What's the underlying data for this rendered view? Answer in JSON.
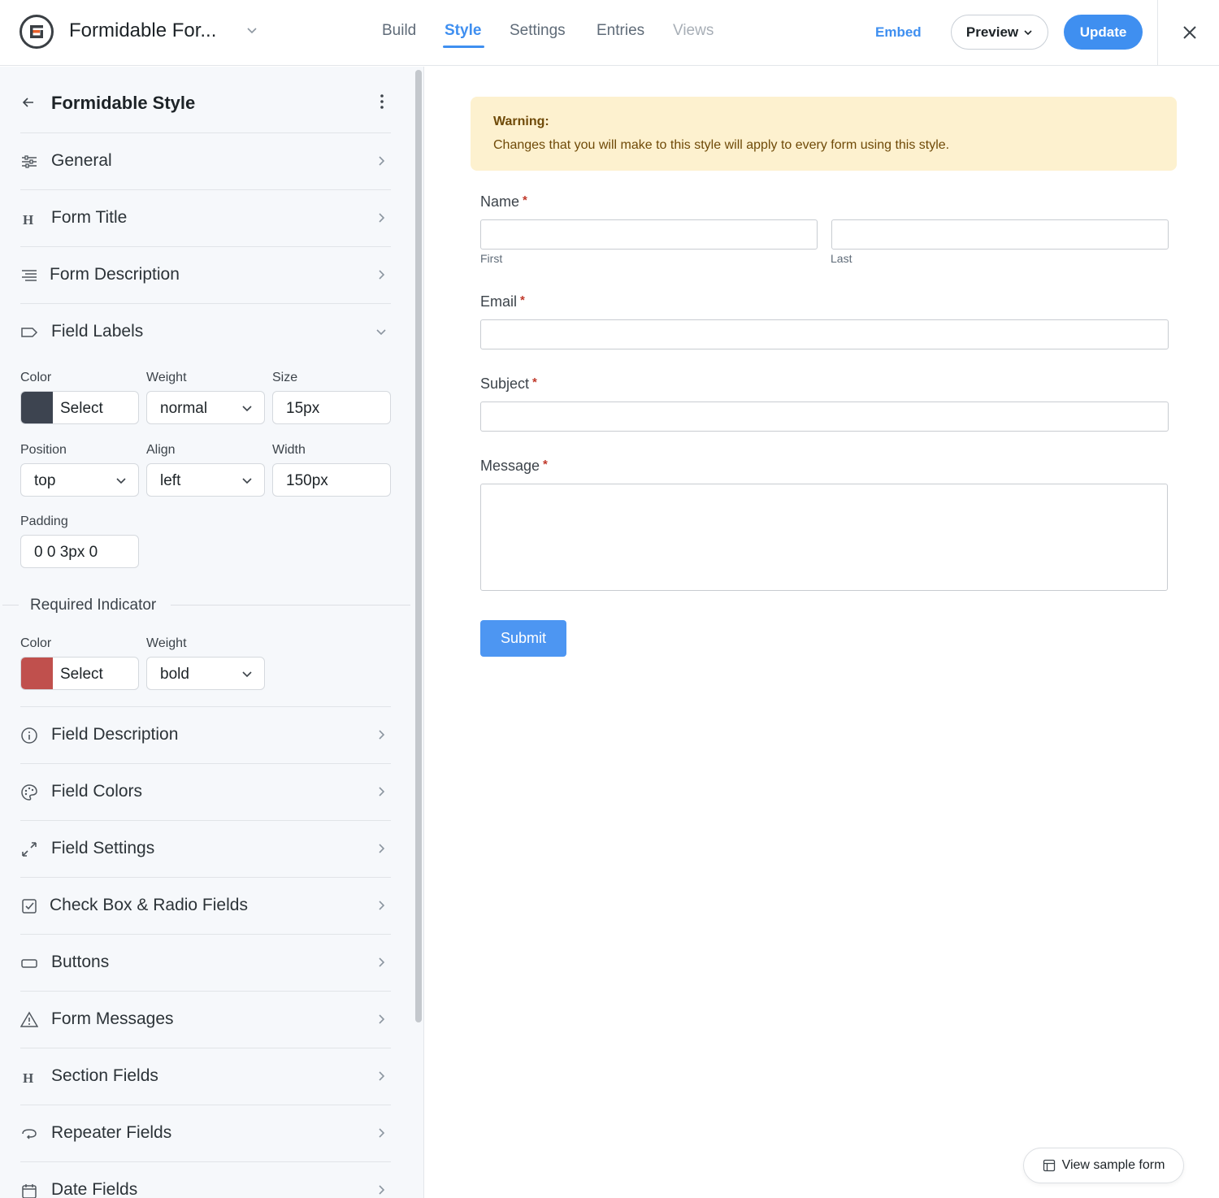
{
  "header": {
    "form_name": "Formidable For...",
    "tabs": [
      {
        "label": "Build"
      },
      {
        "label": "Style"
      },
      {
        "label": "Settings"
      },
      {
        "label": "Entries"
      },
      {
        "label": "Views"
      }
    ],
    "active_tab": "Style",
    "embed_label": "Embed",
    "preview_label": "Preview",
    "update_label": "Update"
  },
  "sidebar": {
    "title": "Formidable Style",
    "sections": [
      {
        "label": "General",
        "icon": "sliders-icon"
      },
      {
        "label": "Form Title",
        "icon": "heading-icon"
      },
      {
        "label": "Form Description",
        "icon": "align-right-icon"
      },
      {
        "label": "Field Labels",
        "icon": "tag-icon",
        "expanded": true
      }
    ],
    "field_labels": {
      "color_label": "Color",
      "color_select": "Select",
      "color_value": "#3d4450",
      "weight_label": "Weight",
      "weight_value": "normal",
      "size_label": "Size",
      "size_value": "15px",
      "position_label": "Position",
      "position_value": "top",
      "align_label": "Align",
      "align_value": "left",
      "width_label": "Width",
      "width_value": "150px",
      "padding_label": "Padding",
      "padding_value": "0 0 3px 0"
    },
    "required_indicator": {
      "title": "Required Indicator",
      "color_label": "Color",
      "color_select": "Select",
      "color_value": "#c0504d",
      "weight_label": "Weight",
      "weight_value": "bold"
    },
    "more_sections": [
      {
        "label": "Field Description",
        "icon": "info-icon"
      },
      {
        "label": "Field Colors",
        "icon": "palette-icon"
      },
      {
        "label": "Field Settings",
        "icon": "expand-icon"
      },
      {
        "label": "Check Box & Radio Fields",
        "icon": "checkbox-icon"
      },
      {
        "label": "Buttons",
        "icon": "button-icon"
      },
      {
        "label": "Form Messages",
        "icon": "warning-icon"
      },
      {
        "label": "Section Fields",
        "icon": "heading-icon"
      },
      {
        "label": "Repeater Fields",
        "icon": "repeat-icon"
      },
      {
        "label": "Date Fields",
        "icon": "calendar-icon"
      }
    ]
  },
  "preview": {
    "warning_title": "Warning:",
    "warning_text": "Changes that you will make to this style will apply to every form using this style.",
    "fields": {
      "name_label": "Name",
      "first_sublabel": "First",
      "last_sublabel": "Last",
      "email_label": "Email",
      "subject_label": "Subject",
      "message_label": "Message",
      "required_mark": "*"
    },
    "submit_label": "Submit",
    "sample_label": "View sample form"
  },
  "colors": {
    "accent": "#3f8ff0",
    "warning_bg": "#fdf1cf",
    "required": "#c0392b"
  }
}
